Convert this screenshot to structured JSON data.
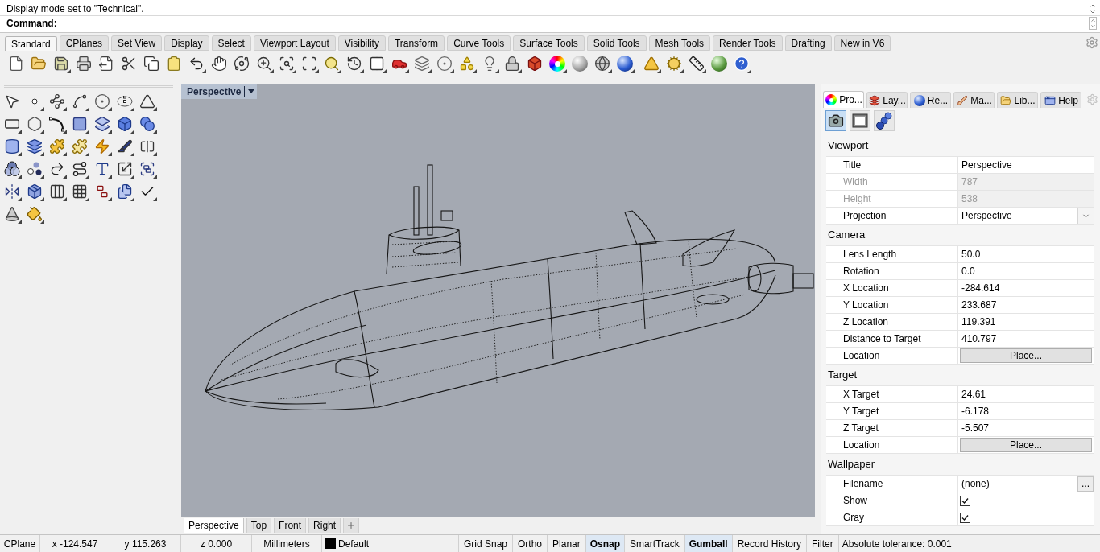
{
  "command_area": {
    "history": [
      "Display mode set to \"Technical\"."
    ],
    "prompt": "Command:"
  },
  "toolbar_tabs": [
    {
      "label": "Standard",
      "selected": true
    },
    {
      "label": "CPlanes",
      "selected": false
    },
    {
      "label": "Set View",
      "selected": false
    },
    {
      "label": "Display",
      "selected": false
    },
    {
      "label": "Select",
      "selected": false
    },
    {
      "label": "Viewport Layout",
      "selected": false
    },
    {
      "label": "Visibility",
      "selected": false
    },
    {
      "label": "Transform",
      "selected": false
    },
    {
      "label": "Curve Tools",
      "selected": false
    },
    {
      "label": "Surface Tools",
      "selected": false
    },
    {
      "label": "Solid Tools",
      "selected": false
    },
    {
      "label": "Mesh Tools",
      "selected": false
    },
    {
      "label": "Render Tools",
      "selected": false
    },
    {
      "label": "Drafting",
      "selected": false
    },
    {
      "label": "New in V6",
      "selected": false
    }
  ],
  "viewport": {
    "title": "Perspective"
  },
  "viewport_tabs": [
    {
      "label": "Perspective",
      "selected": true
    },
    {
      "label": "Top",
      "selected": false
    },
    {
      "label": "Front",
      "selected": false
    },
    {
      "label": "Right",
      "selected": false
    }
  ],
  "panel": {
    "tabs": [
      {
        "label": "Pro...",
        "selected": true
      },
      {
        "label": "Lay...",
        "selected": false
      },
      {
        "label": "Re...",
        "selected": false
      },
      {
        "label": "Ma...",
        "selected": false
      },
      {
        "label": "Lib...",
        "selected": false
      },
      {
        "label": "Help",
        "selected": false
      }
    ],
    "pages": [
      {
        "selected": true
      },
      {
        "selected": false
      },
      {
        "selected": false
      }
    ],
    "sections": [
      {
        "title": "Viewport",
        "rows": [
          {
            "label": "Title",
            "kind": "text",
            "value": "Perspective",
            "disabled": false
          },
          {
            "label": "Width",
            "kind": "text",
            "value": "787",
            "disabled": true
          },
          {
            "label": "Height",
            "kind": "text",
            "value": "538",
            "disabled": true
          },
          {
            "label": "Projection",
            "kind": "dropdown",
            "value": "Perspective",
            "disabled": false
          }
        ]
      },
      {
        "title": "Camera",
        "rows": [
          {
            "label": "Lens Length",
            "kind": "text",
            "value": "50.0",
            "disabled": false
          },
          {
            "label": "Rotation",
            "kind": "text",
            "value": "0.0",
            "disabled": false
          },
          {
            "label": "X Location",
            "kind": "text",
            "value": "-284.614",
            "disabled": false
          },
          {
            "label": "Y Location",
            "kind": "text",
            "value": "233.687",
            "disabled": false
          },
          {
            "label": "Z Location",
            "kind": "text",
            "value": "119.391",
            "disabled": false
          },
          {
            "label": "Distance to Target",
            "kind": "text",
            "value": "410.797",
            "disabled": false
          },
          {
            "label": "Location",
            "kind": "button",
            "value": "Place...",
            "disabled": false
          }
        ]
      },
      {
        "title": "Target",
        "rows": [
          {
            "label": "X Target",
            "kind": "text",
            "value": "24.61",
            "disabled": false
          },
          {
            "label": "Y Target",
            "kind": "text",
            "value": "-6.178",
            "disabled": false
          },
          {
            "label": "Z Target",
            "kind": "text",
            "value": "-5.507",
            "disabled": false
          },
          {
            "label": "Location",
            "kind": "button",
            "value": "Place...",
            "disabled": false
          }
        ]
      },
      {
        "title": "Wallpaper",
        "rows": [
          {
            "label": "Filename",
            "kind": "file",
            "value": "(none)",
            "button": "...",
            "disabled": false
          },
          {
            "label": "Show",
            "kind": "checkbox",
            "checked": true,
            "disabled": false
          },
          {
            "label": "Gray",
            "kind": "checkbox",
            "checked": true,
            "disabled": false
          }
        ]
      }
    ]
  },
  "status_bar": {
    "cplane": "CPlane",
    "x": "x -124.547",
    "y": "y 115.263",
    "z": "z 0.000",
    "units": "Millimeters",
    "layer": {
      "name": "Default",
      "color": "#000000"
    },
    "toggles": [
      {
        "label": "Grid Snap",
        "on": false
      },
      {
        "label": "Ortho",
        "on": false
      },
      {
        "label": "Planar",
        "on": false
      },
      {
        "label": "Osnap",
        "on": true
      },
      {
        "label": "SmartTrack",
        "on": false
      },
      {
        "label": "Gumball",
        "on": true
      },
      {
        "label": "Record History",
        "on": false
      },
      {
        "label": "Filter",
        "on": false
      }
    ],
    "tolerance": "Absolute tolerance: 0.001"
  }
}
